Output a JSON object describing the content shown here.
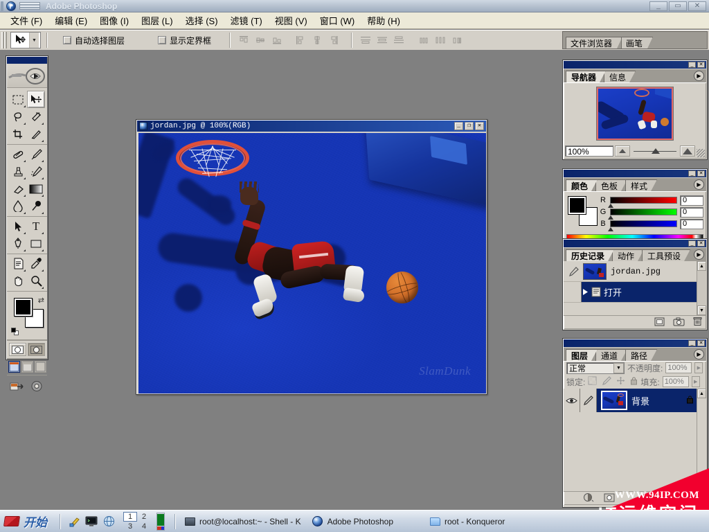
{
  "app": {
    "title": "Adobe Photoshop",
    "window_buttons": [
      "minimize",
      "maximize",
      "close"
    ]
  },
  "menu": {
    "items": [
      "文件 (F)",
      "编辑 (E)",
      "图像 (I)",
      "图层 (L)",
      "选择 (S)",
      "滤镜 (T)",
      "视图 (V)",
      "窗口 (W)",
      "帮助 (H)"
    ]
  },
  "options_bar": {
    "tool_icon": "move-tool-icon",
    "auto_select_layer": {
      "label": "自动选择图层",
      "checked": false
    },
    "show_bounding_box": {
      "label": "显示定界框",
      "checked": false
    },
    "align_buttons": [
      "align-top-edges",
      "align-vertical-centers",
      "align-bottom-edges",
      "align-left-edges",
      "align-horizontal-centers",
      "align-right-edges",
      "distribute-top-edges",
      "distribute-vertical-centers",
      "distribute-bottom-edges",
      "distribute-left-edges",
      "distribute-horizontal-centers",
      "distribute-right-edges"
    ]
  },
  "palette_well": {
    "tabs": [
      "文件浏览器",
      "画笔"
    ]
  },
  "toolbox": {
    "tools": [
      {
        "name": "rectangular-marquee-tool",
        "glyph": "▭",
        "selected": false
      },
      {
        "name": "move-tool",
        "glyph": "move",
        "selected": true
      },
      {
        "name": "lasso-tool",
        "glyph": "lasso",
        "selected": false
      },
      {
        "name": "magic-wand-tool",
        "glyph": "wand",
        "selected": false
      },
      {
        "name": "crop-tool",
        "glyph": "crop",
        "selected": false
      },
      {
        "name": "slice-tool",
        "glyph": "slice",
        "selected": false
      },
      {
        "name": "healing-brush-tool",
        "glyph": "heal",
        "selected": false
      },
      {
        "name": "brush-tool",
        "glyph": "brush",
        "selected": false
      },
      {
        "name": "clone-stamp-tool",
        "glyph": "stamp",
        "selected": false
      },
      {
        "name": "history-brush-tool",
        "glyph": "hbrush",
        "selected": false
      },
      {
        "name": "eraser-tool",
        "glyph": "eraser",
        "selected": false
      },
      {
        "name": "gradient-tool",
        "glyph": "gradient",
        "selected": false
      },
      {
        "name": "blur-tool",
        "glyph": "blur",
        "selected": false
      },
      {
        "name": "dodge-tool",
        "glyph": "dodge",
        "selected": false
      },
      {
        "name": "path-selection-tool",
        "glyph": "arrow",
        "selected": false
      },
      {
        "name": "type-tool",
        "glyph": "T",
        "selected": false
      },
      {
        "name": "pen-tool",
        "glyph": "pen",
        "selected": false
      },
      {
        "name": "rectangle-shape-tool",
        "glyph": "rect",
        "selected": false
      },
      {
        "name": "notes-tool",
        "glyph": "note",
        "selected": false
      },
      {
        "name": "eyedropper-tool",
        "glyph": "eyedrop",
        "selected": false
      },
      {
        "name": "hand-tool",
        "glyph": "hand",
        "selected": false
      },
      {
        "name": "zoom-tool",
        "glyph": "zoom",
        "selected": false
      }
    ],
    "foreground_color": "#000000",
    "background_color": "#ffffff",
    "quickmask": {
      "standard_selected": false,
      "quickmask_selected": true
    },
    "screen_modes": [
      "standard-screen-mode",
      "full-screen-with-menubar",
      "full-screen-mode"
    ],
    "jump_to": [
      "jump-to-imageready",
      "jump-to-other"
    ]
  },
  "document": {
    "title": "jordan.jpg @ 100%(RGB)",
    "zoom": "100%",
    "mode": "RGB",
    "filename": "jordan.jpg",
    "buttons": [
      "minimize",
      "maximize",
      "close"
    ],
    "image_watermark": "SlamDunk"
  },
  "navigator": {
    "tabs": [
      {
        "label": "导航器",
        "active": true
      },
      {
        "label": "信息",
        "active": false
      }
    ],
    "zoom_value": "100%",
    "menu_icon": "palette-menu-icon"
  },
  "color": {
    "tabs": [
      {
        "label": "颜色",
        "active": true
      },
      {
        "label": "色板",
        "active": false
      },
      {
        "label": "样式",
        "active": false
      }
    ],
    "channels": [
      {
        "label": "R",
        "value": "0",
        "color": "#ff0000"
      },
      {
        "label": "G",
        "value": "0",
        "color": "#00ff00"
      },
      {
        "label": "B",
        "value": "0",
        "color": "#0000ff"
      }
    ],
    "foreground": "#000000",
    "background": "#ffffff"
  },
  "history": {
    "tabs": [
      {
        "label": "历史记录",
        "active": true
      },
      {
        "label": "动作",
        "active": false
      },
      {
        "label": "工具预设",
        "active": false
      }
    ],
    "items": [
      {
        "label": "jordan.jpg",
        "selected": false,
        "kind": "snapshot"
      },
      {
        "label": "打开",
        "selected": true,
        "kind": "state"
      }
    ],
    "footer_buttons": [
      "create-document-from-state-icon",
      "create-new-snapshot-icon",
      "delete-state-icon"
    ]
  },
  "layers": {
    "tabs": [
      {
        "label": "图层",
        "active": true
      },
      {
        "label": "通道",
        "active": false
      },
      {
        "label": "路径",
        "active": false
      }
    ],
    "blend_mode": "正常",
    "opacity_label": "不透明度:",
    "opacity_value": "100%",
    "lock_label": "锁定:",
    "lock_icons": [
      "lock-transparent-pixels-icon",
      "lock-image-pixels-icon",
      "lock-position-icon",
      "lock-all-icon"
    ],
    "fill_label": "填充:",
    "fill_value": "100%",
    "items": [
      {
        "name": "背景",
        "visible": true,
        "locked": true,
        "selected": true
      }
    ],
    "footer_buttons": [
      "layer-style-icon",
      "layer-mask-icon"
    ]
  },
  "watermark": {
    "line1": "WWW.94IP.COM",
    "line2": "IT运维空间",
    "color": "#f2002e"
  },
  "taskbar": {
    "start_label": "开始",
    "quick_launch": [
      "show-desktop-icon",
      "terminal-icon",
      "browser-icon"
    ],
    "pager": [
      "1",
      "2",
      "3",
      "4"
    ],
    "pager_active": "1",
    "tasks": [
      {
        "label": "root@localhost:~ - Shell - K",
        "icon": "terminal-icon"
      },
      {
        "label": "Adobe Photoshop",
        "icon": "photoshop-icon"
      },
      {
        "label": "root - Konqueror",
        "icon": "folder-icon"
      }
    ]
  }
}
